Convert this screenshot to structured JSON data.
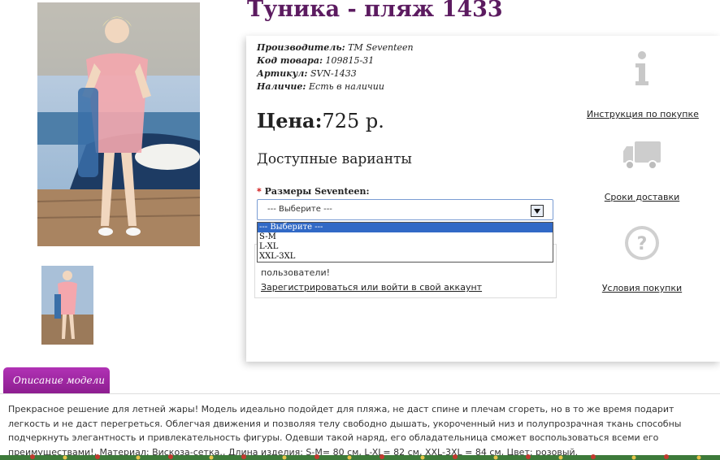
{
  "product": {
    "title": "Туника - пляж 1433"
  },
  "specs": [
    {
      "label": "Производитель:",
      "value": "TM Seventeen"
    },
    {
      "label": "Код товара:",
      "value": "109815-31"
    },
    {
      "label": "Артикул:",
      "value": "SVN-1433"
    },
    {
      "label": "Наличие:",
      "value": "Есть в наличии"
    }
  ],
  "price": {
    "label": "Цена:",
    "value": "725 р."
  },
  "variants": {
    "title": "Доступные варианты",
    "size_label": "Размеры Seventeen:",
    "required_mark": "*",
    "selected": "--- Выберите ---",
    "options": [
      "--- Выберите ---",
      "S-M",
      "L-XL",
      "XXL-3XL"
    ]
  },
  "notice": {
    "text": "пользователи!",
    "link": "Зарегистрироваться или войти в свой аккаунт"
  },
  "side_links": {
    "instruction": "Инструкция по покупке",
    "delivery": "Сроки доставки",
    "conditions": "Условия покупки"
  },
  "description": {
    "tab_label": "Описание модели",
    "text": "Прекрасное решение для летней жары! Модель идеально подойдет для пляжа, не даст спине и плечам сгореть, но в то же время подарит легкость и не даст перегреться. Облегчая движения и позволяя телу свободно дышать, укороченный низ и полупрозрачная ткань способны подчеркнуть элегантность и привлекательность фигуры. Одевши такой наряд, его обладательница сможет воспользоваться всеми его преимуществами!, Материал: Вискоза-сетка., Длина изделия: S-M= 80 см, L-XL= 82 см, XXL-3XL = 84 см, Цвет: розовый."
  },
  "icons": {
    "instruction": "info-icon",
    "delivery": "truck-icon",
    "conditions": "question-icon"
  },
  "colors": {
    "title": "#5c1b60",
    "tab": "#9b2a9e",
    "selected_option": "#3169c6"
  }
}
